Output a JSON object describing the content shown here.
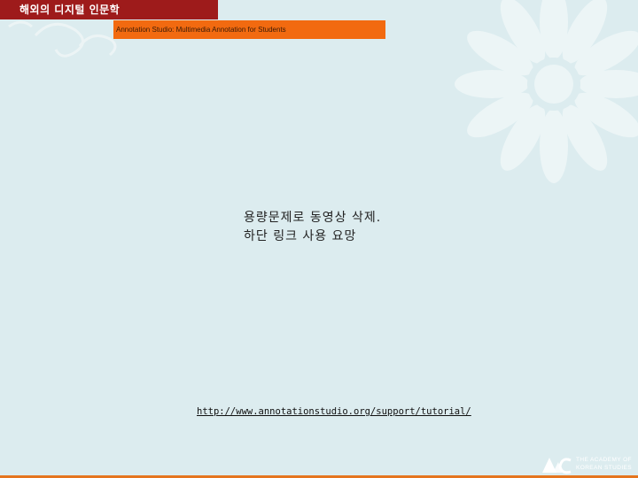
{
  "header": {
    "title": "해외의 디지털 인문학"
  },
  "subtitle": {
    "text": "Annotation Studio: Multimedia Annotation for Students"
  },
  "notice": {
    "line1": "용량문제로 동영상 삭제.",
    "line2": "하단 링크 사용 요망"
  },
  "link": {
    "url": "http://www.annotationstudio.org/support/tutorial/"
  },
  "logo": {
    "line1": "THE ACADEMY OF",
    "line2": "KOREAN STUDIES"
  },
  "colors": {
    "background": "#dcecef",
    "header_bar": "#9e1b1b",
    "subtitle_bar": "#f26a10",
    "bottom_line": "#e5751e"
  }
}
